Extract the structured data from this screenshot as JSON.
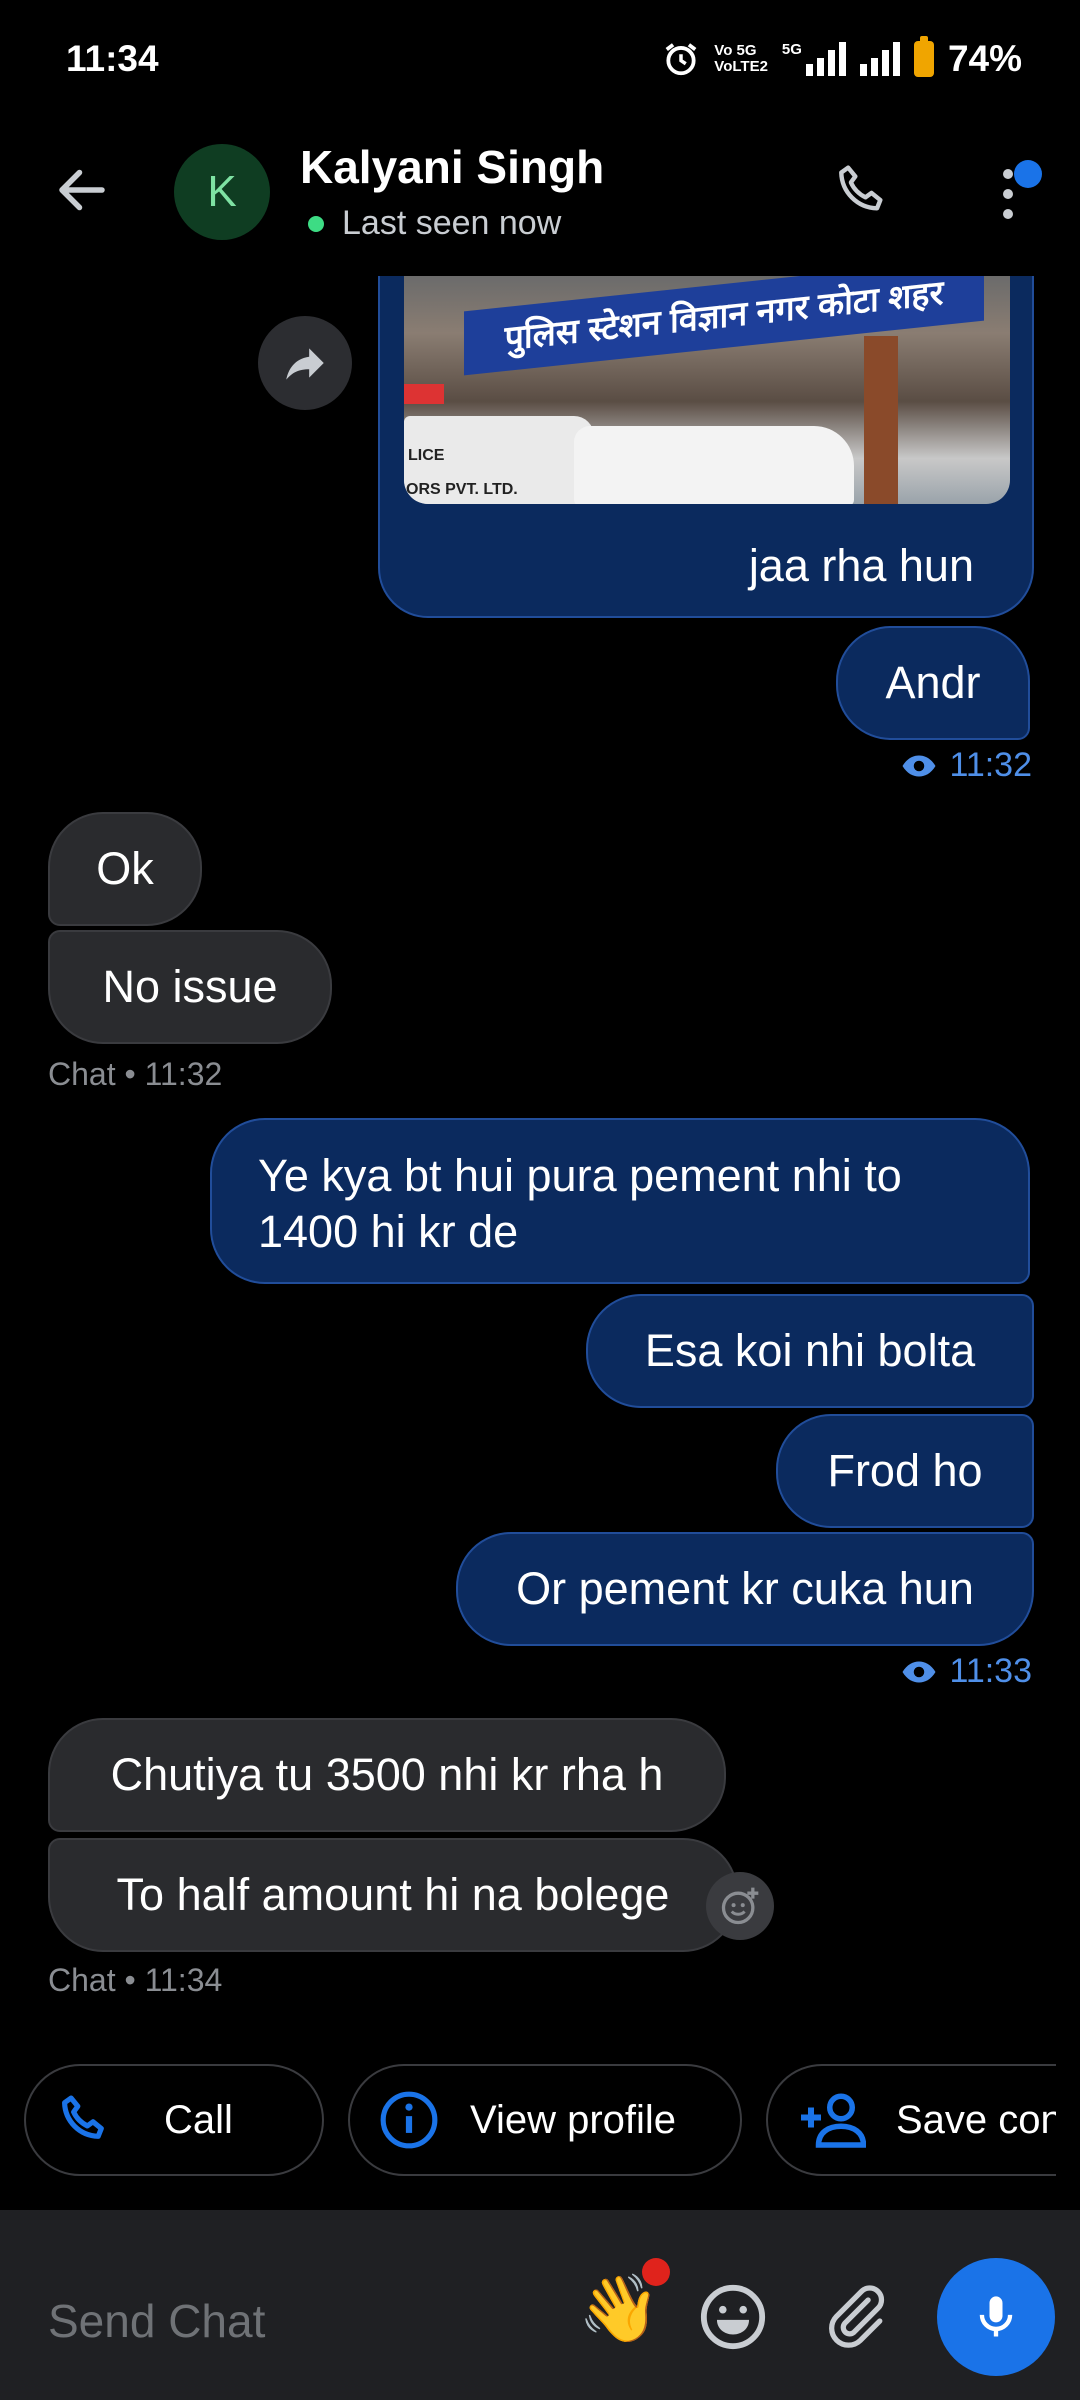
{
  "status_bar": {
    "time": "11:34",
    "network_top": "Vo 5G",
    "network_bottom": "VoLTE2",
    "net_5g": "5G",
    "battery": "74%"
  },
  "header": {
    "avatar_letter": "K",
    "name": "Kalyani Singh",
    "status": "Last seen now"
  },
  "messages": {
    "image_caption": "jaa rha hun",
    "image_sign_text": "पुलिस स्टेशन विज्ञान नगर कोटा शहर",
    "image_car_text_1": "LICE",
    "image_car_text_2": "ORS PVT. LTD.",
    "out_andr": "Andr",
    "seen_time_1": "11:32",
    "in_ok": "Ok",
    "in_no_issue": "No issue",
    "chat_time_1": "Chat • 11:32",
    "out_1": "Ye kya bt hui pura pement nhi to 1400 hi kr de",
    "out_2": "Esa koi nhi bolta",
    "out_3": "Frod ho",
    "out_4": "Or pement kr cuka hun",
    "seen_time_2": "11:33",
    "in_1": "Chutiya tu 3500 nhi kr rha h",
    "in_2": "To half amount hi na bolege",
    "chat_time_2": "Chat • 11:34"
  },
  "actions": {
    "call": "Call",
    "view_profile": "View profile",
    "save_contact": "Save con"
  },
  "input": {
    "placeholder": "Send Chat",
    "wave_emoji": "👋"
  },
  "colors": {
    "accent": "#1a73e8",
    "outgoing_bubble": "#0b2a5e",
    "incoming_bubble": "#2a2b2e",
    "online": "#3ddc84"
  }
}
